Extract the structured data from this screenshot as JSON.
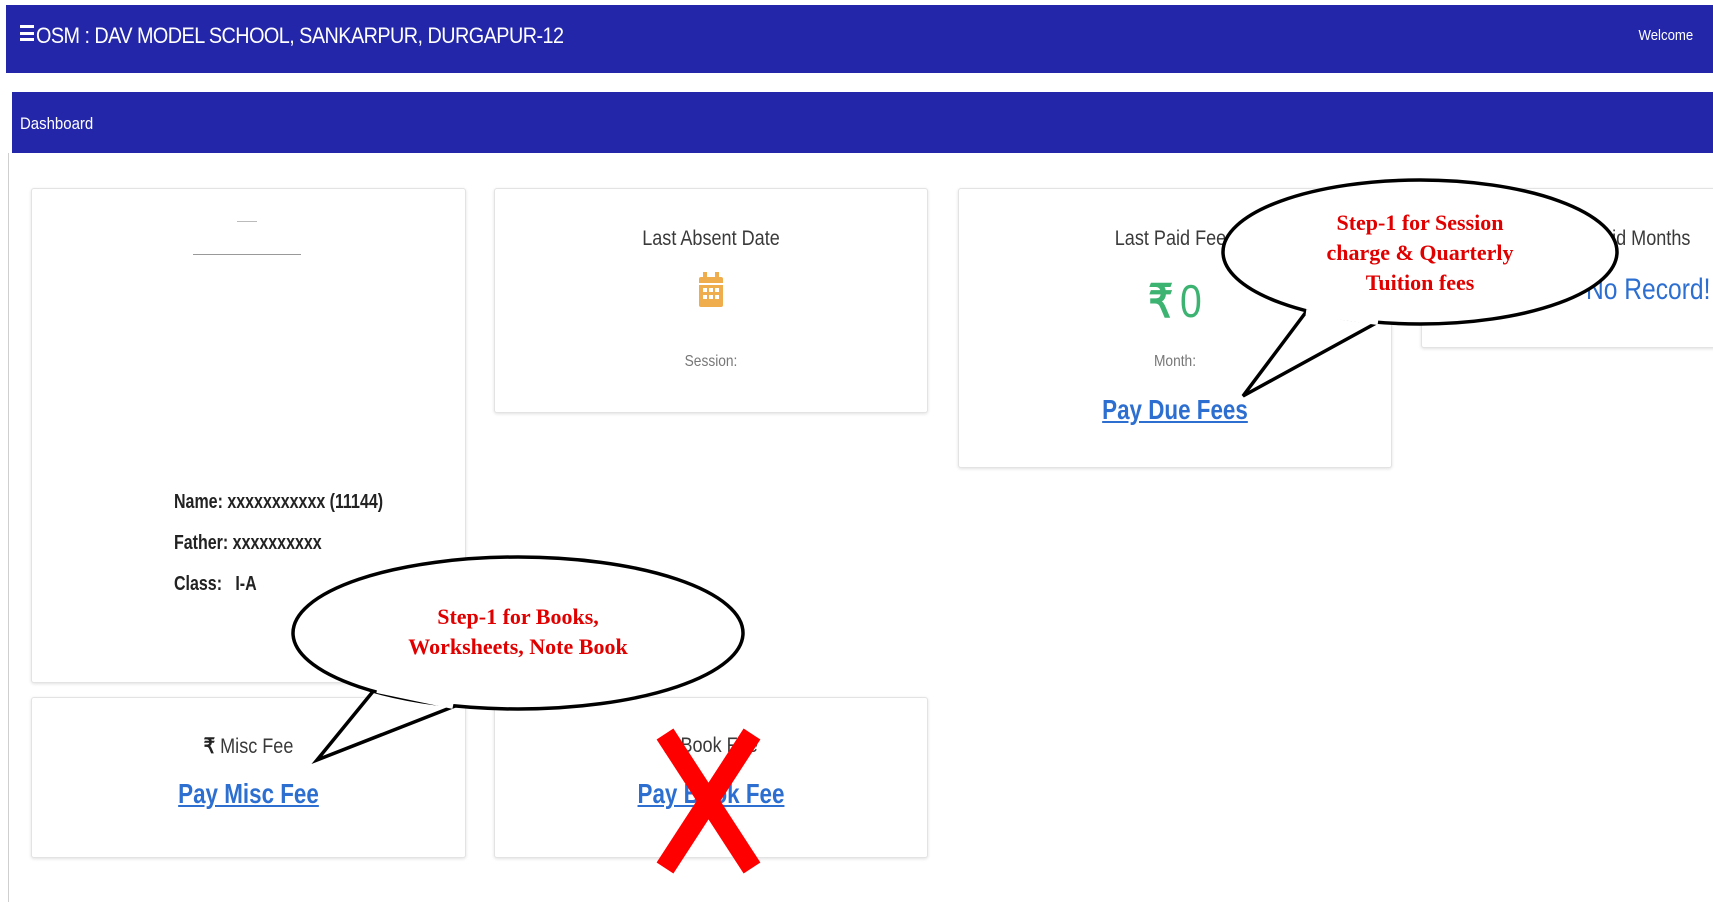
{
  "header": {
    "title": "OSM : DAV MODEL SCHOOL, SANKARPUR, DURGAPUR-12",
    "welcome": "Welcome"
  },
  "subheader": {
    "title": "Dashboard"
  },
  "student": {
    "name_line": "Name: xxxxxxxxxxx (11144)",
    "father_line": "Father: xxxxxxxxxx",
    "class_line": "Class:   I-A"
  },
  "absent_card": {
    "title": "Last Absent Date",
    "session_label": "Session:"
  },
  "fees_card": {
    "title": "Last Paid Fees",
    "amount_symbol": "₹",
    "amount": "0",
    "month_label": "Month:",
    "pay_link": "Pay Due Fees"
  },
  "paid_months_card": {
    "title": "Paid Months",
    "value": "No Record!"
  },
  "misc_card": {
    "label_symbol": "₹",
    "label": "Misc Fee",
    "pay_link": "Pay Misc Fee"
  },
  "book_card": {
    "label": "Book Fee",
    "pay_link": "Pay Book Fee"
  },
  "annotations": {
    "bubble_session": [
      "Step-1 for Session",
      "charge & Quarterly",
      "Tuition fees"
    ],
    "bubble_books": [
      "Step-1 for Books,",
      "Worksheets, Note Book"
    ]
  },
  "colors": {
    "header_bg": "#2326a8",
    "link": "#2d6fd0",
    "green_amount": "#3cb371",
    "calendar": "#f0ad4e",
    "paid_months_value": "#2d6fd0",
    "annotation_text": "#e00000",
    "cross_mark": "#ff0000"
  },
  "icons": {
    "menu": "hamburger-icon",
    "calendar": "calendar-icon",
    "rupee": "rupee-icon",
    "book": "book-icon"
  }
}
